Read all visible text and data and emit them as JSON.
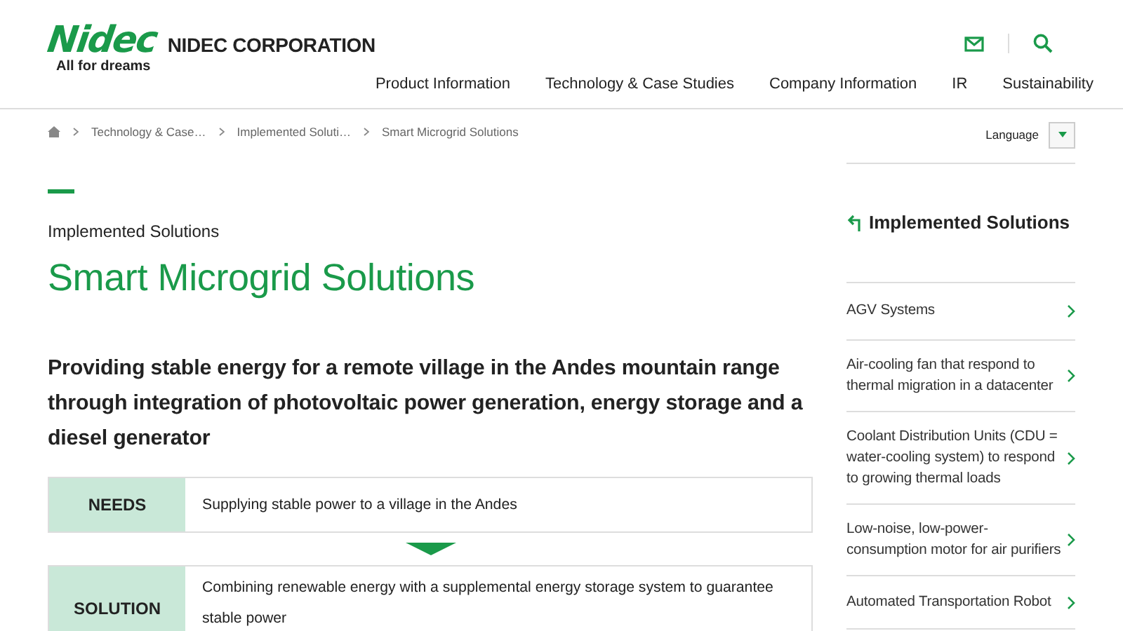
{
  "header": {
    "logo": "Nidec",
    "tagline": "All for dreams",
    "company": "NIDEC CORPORATION",
    "nav": [
      "Product Information",
      "Technology & Case Studies",
      "Company Information",
      "IR",
      "Sustainability"
    ]
  },
  "breadcrumb": [
    "Technology & Case…",
    "Implemented Soluti…",
    "Smart Microgrid Solutions"
  ],
  "language": {
    "label": "Language"
  },
  "page": {
    "category": "Implemented Solutions",
    "title": "Smart Microgrid Solutions",
    "lead": "Providing stable energy for a remote village in the Andes mountain range through integration of photovoltaic power generation, energy storage and a diesel generator"
  },
  "blocks": [
    {
      "label": "NEEDS",
      "text": "Supplying stable power to a village in the Andes"
    },
    {
      "label": "SOLUTION",
      "text": "Combining renewable energy with a supplemental energy storage system to guarantee stable power"
    }
  ],
  "sidebar": {
    "title": "Implemented Solutions",
    "items": [
      "AGV Systems",
      "Air-cooling fan that respond to thermal migration in a datacenter",
      "Coolant Distribution Units (CDU = water-cooling system) to respond to growing thermal loads",
      "Low-noise, low-power-consumption motor for air purifiers",
      "Automated Transportation Robot"
    ]
  }
}
